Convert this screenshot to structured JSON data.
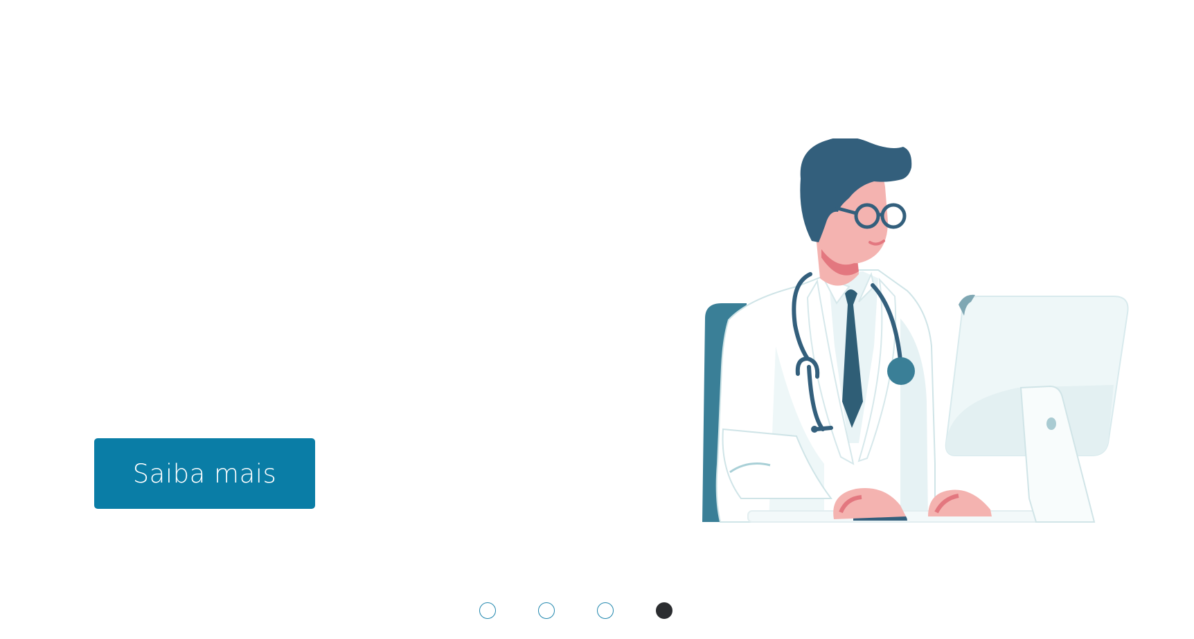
{
  "hero": {
    "cta_label": "Saiba mais"
  },
  "illustration": {
    "subject": "doctor-at-computer-illustration"
  },
  "carousel": {
    "slide_count": 4,
    "active_index": 3
  },
  "colors": {
    "button_bg": "#0a7da6",
    "button_text": "#ffffff",
    "dot_border": "#1f86ad",
    "dot_active": "#2b2d30",
    "hair": "#335f7c",
    "chair": "#3a7f97",
    "skin": "#f4b3b0",
    "skin_shadow": "#e3777f",
    "coat": "#ffffff",
    "coat_shadow": "#dceff1",
    "monitor": "#eef7f8"
  }
}
